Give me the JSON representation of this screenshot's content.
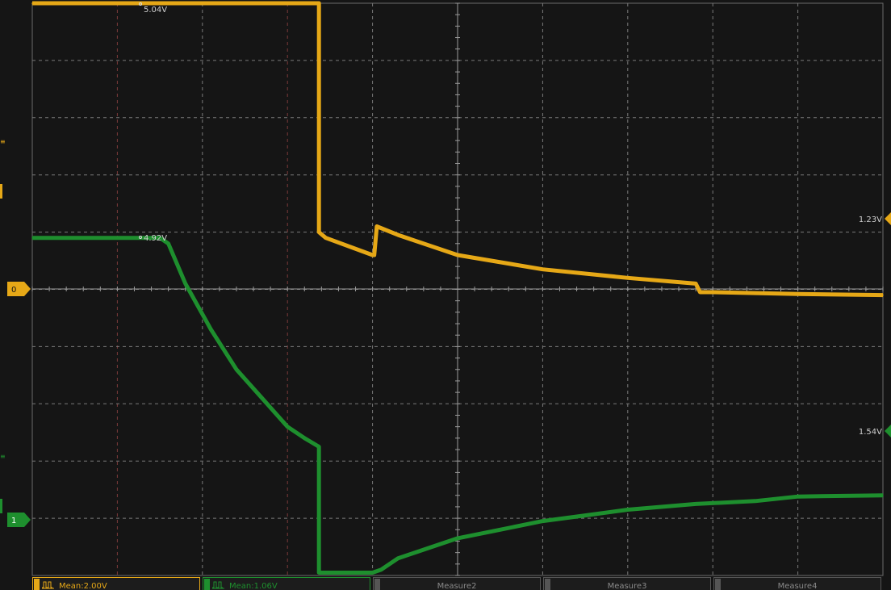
{
  "colors": {
    "ch1": "#e6a817",
    "ch2": "#1e8f2e",
    "grid": "#7a7a7a",
    "background": "#151515"
  },
  "markers": {
    "ch1_level": "0",
    "ch2_level": "1",
    "ch1_cursor_readout": "1.23V",
    "ch2_cursor_readout": "1.54V",
    "ch1_peak_readout": "5.04V",
    "ch2_peak_readout": "4.92V"
  },
  "measurements": [
    {
      "label": "Mean:2.00V",
      "channel": "ch1"
    },
    {
      "label": "Mean:1.06V",
      "channel": "ch2"
    },
    {
      "label": "Measure2",
      "channel": "none"
    },
    {
      "label": "Measure3",
      "channel": "none"
    },
    {
      "label": "Measure4",
      "channel": "none"
    }
  ],
  "chart_data": {
    "type": "line",
    "title": "",
    "xlabel": "",
    "ylabel": "",
    "grid": true,
    "grid_divisions": {
      "x": 10,
      "y": 10
    },
    "xlim": [
      0,
      10
    ],
    "ylim": [
      0,
      10
    ],
    "series": [
      {
        "channel": "ch1",
        "x": [
          0.0,
          3.37,
          3.37,
          3.45,
          4.0,
          4.02,
          4.05,
          4.3,
          5.0,
          6.0,
          7.0,
          7.8,
          7.85,
          8.0,
          9.0,
          10.0
        ],
        "y": [
          10.0,
          10.0,
          6.0,
          5.9,
          5.6,
          5.6,
          6.1,
          5.95,
          5.6,
          5.35,
          5.2,
          5.1,
          4.95,
          4.95,
          4.92,
          4.9
        ]
      },
      {
        "channel": "ch2",
        "x": [
          0.0,
          1.5,
          1.6,
          1.8,
          2.1,
          2.4,
          2.7,
          3.0,
          3.2,
          3.37,
          3.37,
          4.0,
          4.1,
          4.3,
          4.7,
          5.0,
          5.5,
          6.0,
          6.5,
          7.0,
          7.8,
          8.5,
          9.0,
          10.0
        ],
        "y": [
          5.9,
          5.9,
          5.8,
          5.1,
          4.3,
          3.6,
          3.1,
          2.6,
          2.4,
          2.25,
          0.05,
          0.05,
          0.1,
          0.3,
          0.5,
          0.65,
          0.8,
          0.95,
          1.05,
          1.15,
          1.25,
          1.3,
          1.38,
          1.4
        ]
      }
    ]
  }
}
